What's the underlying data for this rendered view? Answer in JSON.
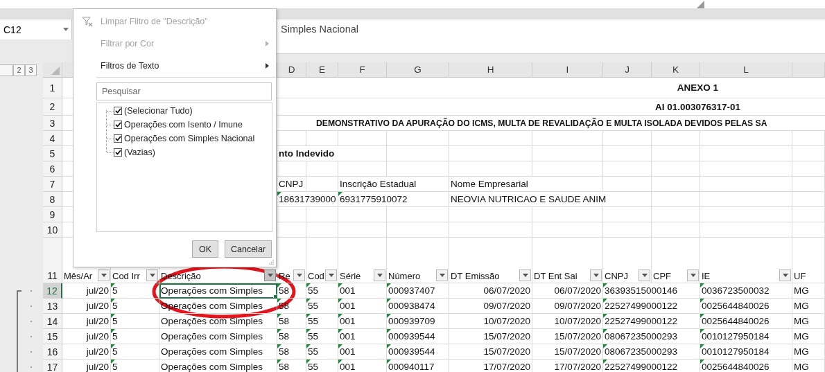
{
  "formula_bar": {
    "name_box": "C12",
    "formula": "Simples Nacional"
  },
  "outline": {
    "levels": [
      "2",
      "3"
    ]
  },
  "column_headers": [
    "D",
    "E",
    "F",
    "G",
    "H",
    "I",
    "J",
    "K",
    "L"
  ],
  "top_rows": [
    {
      "number": "1",
      "kind": "title",
      "text": "ANEXO 1"
    },
    {
      "number": "2",
      "kind": "title",
      "text": "AI 01.003076317-01"
    },
    {
      "number": "3",
      "kind": "heading",
      "text": "DEMONSTRATIVO DA APURAÇÃO DO ICMS, MULTA DE REVALIDAÇÃO E MULTA ISOLADA DEVIDOS PELAS SA"
    },
    {
      "number": "4",
      "kind": "plain",
      "cells": {}
    },
    {
      "number": "5",
      "kind": "label",
      "cells": {
        "D": {
          "text": "nto Indevido",
          "flagged": false
        }
      }
    },
    {
      "number": "6",
      "kind": "plain",
      "cells": {}
    },
    {
      "number": "7",
      "kind": "plain",
      "cells": {
        "D": {
          "text": "CNPJ",
          "flagged": false
        },
        "F": {
          "text": "Inscrição Estadual",
          "flagged": false
        },
        "H": {
          "text": "Nome Empresarial",
          "flagged": false
        }
      }
    },
    {
      "number": "8",
      "kind": "plain",
      "cells": {
        "D": {
          "text": "18631739000",
          "flagged": true
        },
        "F": {
          "text": "6931775910072",
          "flagged": true
        },
        "H": {
          "text": "NEOVIA NUTRICAO E SAUDE ANIM",
          "flagged": false
        }
      }
    },
    {
      "number": "9",
      "kind": "plain",
      "cells": {}
    },
    {
      "number": "10",
      "kind": "plain",
      "cells": {}
    }
  ],
  "table": {
    "header_row": "11",
    "columns": [
      {
        "label": "Mês/Ar",
        "filter": true,
        "kind": "date",
        "flagged": false,
        "selected": false
      },
      {
        "label": "Cod Irr",
        "filter": true,
        "kind": "text",
        "flagged": true,
        "selected": false
      },
      {
        "label": "Descrição",
        "filter": true,
        "kind": "text",
        "flagged": false,
        "selected": true
      },
      {
        "label": "Re",
        "filter": true,
        "kind": "text",
        "flagged": true,
        "selected": false
      },
      {
        "label": "Cod",
        "filter": true,
        "kind": "text",
        "flagged": true,
        "selected": false
      },
      {
        "label": "Série",
        "filter": true,
        "kind": "text",
        "flagged": true,
        "selected": false
      },
      {
        "label": "Número",
        "filter": true,
        "kind": "text",
        "flagged": true,
        "selected": false
      },
      {
        "label": "DT Emissão",
        "filter": true,
        "kind": "date",
        "flagged": false,
        "selected": false
      },
      {
        "label": "DT Ent Sai",
        "filter": true,
        "kind": "date",
        "flagged": false,
        "selected": false
      },
      {
        "label": "CNPJ",
        "filter": true,
        "kind": "text",
        "flagged": true,
        "selected": false
      },
      {
        "label": "CPF",
        "filter": true,
        "selected": false
      },
      {
        "label": "IE",
        "filter": true,
        "kind": "text",
        "flagged": true,
        "selected": false
      },
      {
        "label": "UF",
        "filter": false,
        "kind": "text",
        "flagged": false,
        "selected": false
      }
    ],
    "rows": [
      {
        "number": "12",
        "selected": true,
        "cells": {
          "A": "jul/20",
          "B": "5",
          "C": "Operações com Simples",
          "D": "58",
          "E": "55",
          "F": "001",
          "G": "000937407",
          "H": "06/07/2020",
          "I": "06/07/2020",
          "J": "36393515000146",
          "L": "0036723500032",
          "M": "MG"
        }
      },
      {
        "number": "13",
        "selected": false,
        "cells": {
          "A": "jul/20",
          "B": "5",
          "C": "Operações com Simples",
          "D": "58",
          "E": "55",
          "F": "001",
          "G": "000938474",
          "H": "09/07/2020",
          "I": "09/07/2020",
          "J": "22527499000122",
          "L": "0025644840026",
          "M": "MG"
        }
      },
      {
        "number": "14",
        "selected": false,
        "cells": {
          "A": "jul/20",
          "B": "5",
          "C": "Operações com Simples",
          "D": "58",
          "E": "55",
          "F": "001",
          "G": "000939709",
          "H": "10/07/2020",
          "I": "10/07/2020",
          "J": "22527499000122",
          "L": "0025644840026",
          "M": "MG"
        }
      },
      {
        "number": "15",
        "selected": false,
        "cells": {
          "A": "jul/20",
          "B": "5",
          "C": "Operações com Simples",
          "D": "58",
          "E": "55",
          "F": "001",
          "G": "000939544",
          "H": "15/07/2020",
          "I": "15/07/2020",
          "J": "08067235000293",
          "L": "0010127950184",
          "M": "MG"
        }
      },
      {
        "number": "16",
        "selected": false,
        "cells": {
          "A": "jul/20",
          "B": "5",
          "C": "Operações com Simples",
          "D": "58",
          "E": "55",
          "F": "001",
          "G": "000939544",
          "H": "15/07/2020",
          "I": "15/07/2020",
          "J": "08067235000293",
          "L": "0010127950184",
          "M": "MG"
        }
      },
      {
        "number": "17",
        "selected": false,
        "cells": {
          "A": "jul/20",
          "B": "5",
          "C": "Operações com Simples",
          "D": "58",
          "E": "55",
          "F": "001",
          "G": "000940117",
          "H": "17/07/2020",
          "I": "17/07/2020",
          "J": "22527499000122",
          "L": "0025644840026",
          "M": "MG"
        }
      }
    ]
  },
  "filter_menu": {
    "items": [
      {
        "label": "Limpar Filtro de \"Descrição\"",
        "kind": "clear",
        "disabled": true,
        "submenu": false
      },
      {
        "label": "Filtrar por Cor",
        "kind": "plain",
        "disabled": true,
        "submenu": true
      },
      {
        "label": "Filtros de Texto",
        "kind": "plain",
        "disabled": false,
        "submenu": true
      }
    ],
    "search": {
      "placeholder": "Pesquisar"
    },
    "values": [
      {
        "label": "(Selecionar Tudo)",
        "checked": true
      },
      {
        "label": "Operações com Isento / Imune",
        "checked": true
      },
      {
        "label": "Operações com Simples Nacional",
        "checked": true
      },
      {
        "label": "(Vazias)",
        "checked": true
      }
    ],
    "buttons": [
      "OK",
      "Cancelar"
    ]
  }
}
